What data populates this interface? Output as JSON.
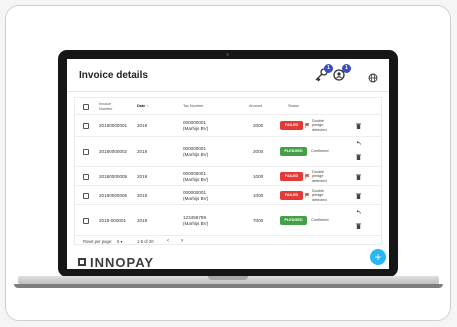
{
  "app": {
    "title": "Invoice details"
  },
  "header": {
    "notifications_badge": "1",
    "users_badge": "1",
    "icons": [
      "key-icon",
      "user-refresh-icon",
      "globe-icon"
    ]
  },
  "table": {
    "columns": {
      "invoice_number": "Invoice Number",
      "date": "Date ↑",
      "tax_number": "Tax Number",
      "amount": "Amount",
      "status": "Status"
    },
    "rows": [
      {
        "invoice": "20180000001",
        "date": "2019",
        "tax1": "000000001",
        "tax2": "(Marhijs BV)",
        "amount": "2000",
        "status": "FAILED",
        "note1": "Double",
        "note2": "pledge",
        "note3": "detected",
        "undo": false
      },
      {
        "invoice": "20180000002",
        "date": "2019",
        "tax1": "000000001",
        "tax2": "(Marhijs BV)",
        "amount": "2000",
        "status": "PLEDGED",
        "note1": "Confirmed",
        "note2": "",
        "note3": "",
        "undo": true
      },
      {
        "invoice": "20180000005",
        "date": "2019",
        "tax1": "000000001",
        "tax2": "(Marhijs BV)",
        "amount": "1000",
        "status": "FAILED",
        "note1": "Double",
        "note2": "pledge",
        "note3": "detected",
        "undo": false
      },
      {
        "invoice": "20180000006",
        "date": "2019",
        "tax1": "000000001",
        "tax2": "(Marhijs BV)",
        "amount": "1000",
        "status": "FAILED",
        "note1": "Double",
        "note2": "pledge",
        "note3": "detected",
        "undo": false
      },
      {
        "invoice": "2018-000001",
        "date": "2019",
        "tax1": "123456789",
        "tax2": "(Marhijs BV)",
        "amount": "7000",
        "status": "PLEDGED",
        "note1": "Confirmed",
        "note2": "",
        "note3": "",
        "undo": true
      }
    ]
  },
  "pager": {
    "rows_per_page_label": "Rows per page:",
    "rows_per_page_value": "5 ▾",
    "range": "1-5 of 20",
    "prev": "‹",
    "next": "›"
  },
  "brand": {
    "name": "INNOPAY"
  },
  "fab": {
    "label": "+"
  },
  "colors": {
    "failed": "#e53935",
    "pledged": "#43a047",
    "accent": "#29b6f6",
    "badge": "#3b4cc0"
  }
}
